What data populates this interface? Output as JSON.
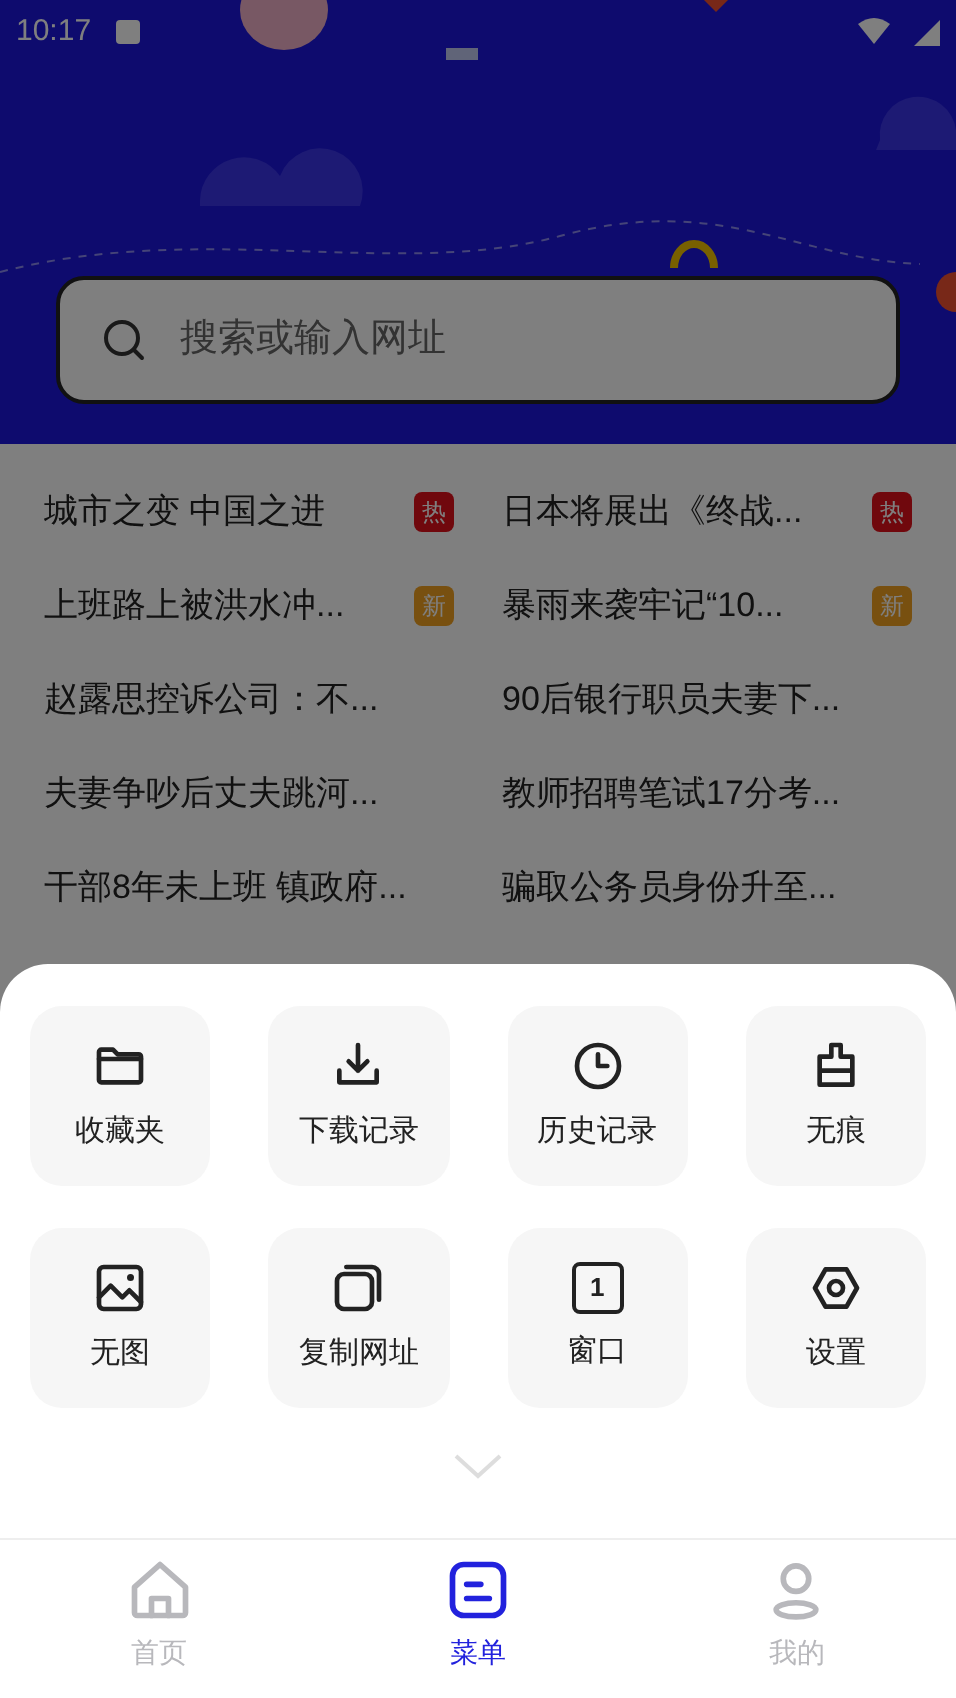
{
  "status_bar": {
    "time": "10:17"
  },
  "search": {
    "placeholder": "搜索或输入网址"
  },
  "news": [
    {
      "title": "城市之变 中国之进",
      "badge": {
        "text": "热",
        "kind": "hot"
      }
    },
    {
      "title": "日本将展出《终战...",
      "badge": {
        "text": "热",
        "kind": "hot"
      }
    },
    {
      "title": "上班路上被洪水冲...",
      "badge": {
        "text": "新",
        "kind": "new"
      }
    },
    {
      "title": "暴雨来袭牢记“10...",
      "badge": {
        "text": "新",
        "kind": "new"
      }
    },
    {
      "title": "赵露思控诉公司：不..."
    },
    {
      "title": "90后银行职员夫妻下..."
    },
    {
      "title": "夫妻争吵后丈夫跳河..."
    },
    {
      "title": "教师招聘笔试17分考..."
    },
    {
      "title": "干部8年未上班 镇政府..."
    },
    {
      "title": "骗取公务员身份升至..."
    }
  ],
  "menu": [
    {
      "label": "收藏夹"
    },
    {
      "label": "下载记录"
    },
    {
      "label": "历史记录"
    },
    {
      "label": "无痕"
    },
    {
      "label": "无图"
    },
    {
      "label": "复制网址"
    },
    {
      "label": "窗口",
      "icon_text": "1"
    },
    {
      "label": "设置"
    }
  ],
  "bottom_nav": [
    {
      "label": "首页",
      "selected": false
    },
    {
      "label": "菜单",
      "selected": true
    },
    {
      "label": "我的",
      "selected": false
    }
  ]
}
